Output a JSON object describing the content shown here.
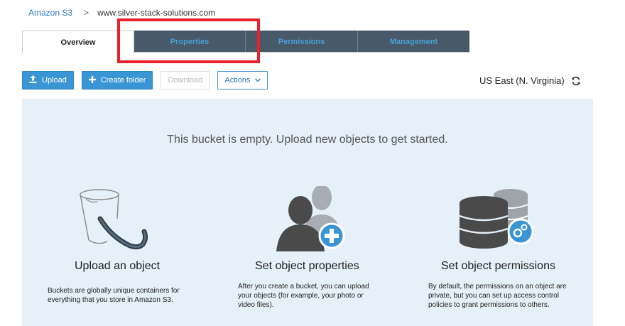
{
  "breadcrumb": {
    "root": "Amazon S3",
    "separator": ">",
    "current": "www.silver-stack-solutions.com"
  },
  "tabs": [
    {
      "label": "Overview",
      "active": true
    },
    {
      "label": "Properties",
      "active": false
    },
    {
      "label": "Permissions",
      "active": false
    },
    {
      "label": "Management",
      "active": false
    }
  ],
  "toolbar": {
    "upload_label": "Upload",
    "create_folder_label": "Create folder",
    "download_label": "Download",
    "actions_label": "Actions"
  },
  "region": "US East (N. Virginia)",
  "empty_state": {
    "message": "This bucket is empty. Upload new objects to get started.",
    "columns": [
      {
        "title": "Upload an object",
        "text_lines": [
          "Buckets are globally unique containers for",
          "everything that you store in Amazon S3."
        ],
        "icon": "bucket-icon"
      },
      {
        "title": "Set object properties",
        "text_lines": [
          "After you create a bucket, you can upload",
          "your objects (for example, your photo or",
          "video files)."
        ],
        "icon": "users-plus-icon"
      },
      {
        "title": "Set object permissions",
        "text_lines": [
          "By default, the permissions on an object are",
          "private, but you can set up access control",
          "policies to grant permissions to others."
        ],
        "icon": "database-gear-icon"
      }
    ]
  },
  "colors": {
    "link": "#2a7bbf",
    "primary_button": "#3a95d4",
    "inactive_tab_bg": "#485a69",
    "panel_bg": "#e6f0f8",
    "highlight": "#e8212b"
  }
}
